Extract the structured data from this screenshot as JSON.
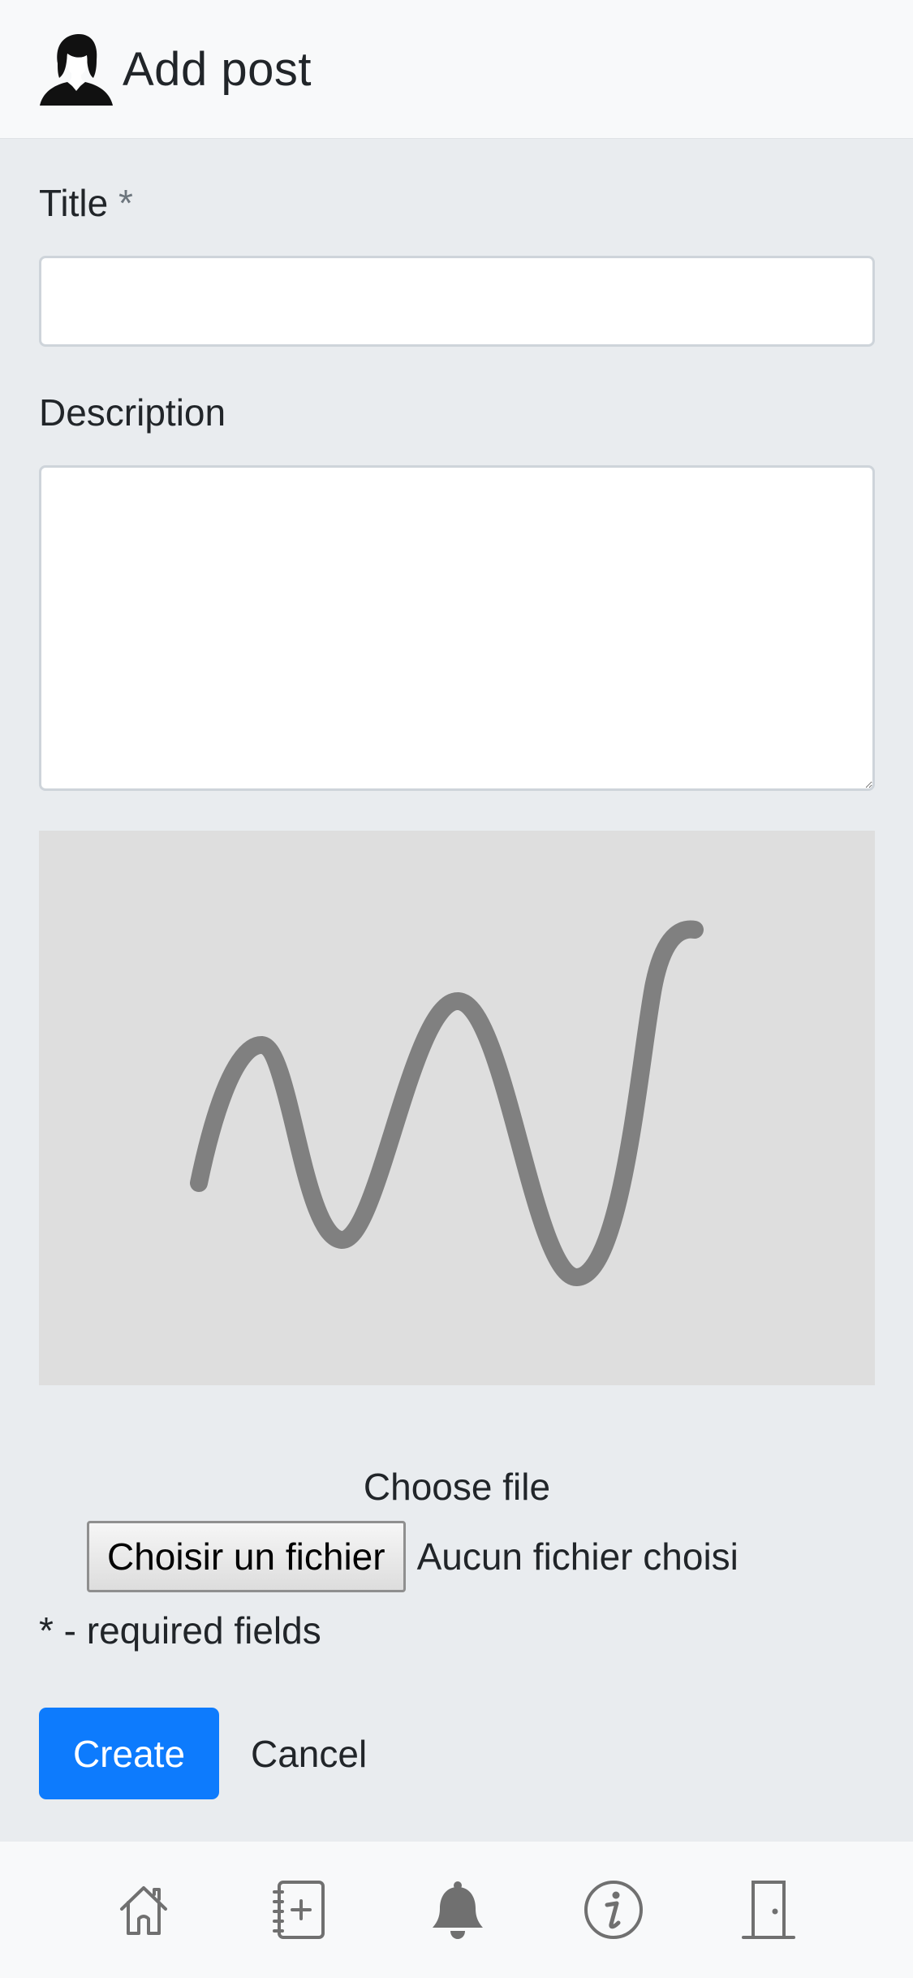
{
  "header": {
    "title": "Add post",
    "avatar_icon": "user-avatar-icon"
  },
  "form": {
    "title_label": "Title",
    "required_star": "*",
    "title_value": "",
    "description_label": "Description",
    "description_value": "",
    "image_preview_icon": "signature-squiggle-icon",
    "choose_file_label": "Choose file",
    "file_button_label": "Choisir un fichier",
    "file_status": "Aucun fichier choisi",
    "required_note": "* - required fields",
    "create_label": "Create",
    "cancel_label": "Cancel"
  },
  "bottom_nav": [
    {
      "icon": "home-icon"
    },
    {
      "icon": "add-note-icon"
    },
    {
      "icon": "bell-icon"
    },
    {
      "icon": "info-icon"
    },
    {
      "icon": "door-exit-icon"
    }
  ],
  "colors": {
    "primary": "#0d7bfd",
    "header_bg": "#f8f9fa",
    "page_bg": "#e9ecef",
    "preview_bg": "#dedede",
    "stroke": "#808080"
  }
}
